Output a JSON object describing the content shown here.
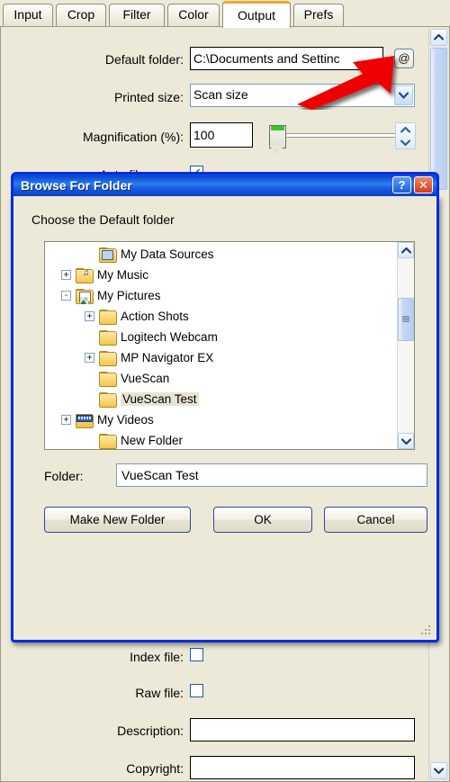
{
  "app": {
    "tabs": [
      {
        "label": "Input",
        "active": false
      },
      {
        "label": "Crop",
        "active": false
      },
      {
        "label": "Filter",
        "active": false
      },
      {
        "label": "Color",
        "active": false
      },
      {
        "label": "Output",
        "active": true
      },
      {
        "label": "Prefs",
        "active": false
      }
    ],
    "fields": {
      "default_folder_label": "Default folder:",
      "default_folder_value": "C:\\Documents and Settinc",
      "browse_button_glyph": "@",
      "printed_size_label": "Printed size:",
      "printed_size_value": "Scan size",
      "magnification_label": "Magnification (%):",
      "magnification_value": "100",
      "auto_file_name_label": "Auto file name:",
      "auto_file_name_checked": "✔",
      "index_file_label": "Index file:",
      "index_file_checked": "",
      "raw_file_label": "Raw file:",
      "raw_file_checked": "",
      "description_label": "Description:",
      "description_value": "",
      "copyright_label": "Copyright:",
      "copyright_value": ""
    },
    "accent_color": "#f0a830"
  },
  "dialog": {
    "title": "Browse For Folder",
    "help_button": "?",
    "close_button": "✕",
    "prompt": "Choose the Default folder",
    "tree": [
      {
        "label": "My Data Sources",
        "indent": 1,
        "expander": "",
        "icon": "special-folder",
        "selected": false
      },
      {
        "label": "My Music",
        "indent": 0,
        "expander": "+",
        "icon": "music-folder",
        "selected": false
      },
      {
        "label": "My Pictures",
        "indent": 0,
        "expander": "-",
        "icon": "pictures-folder",
        "selected": false
      },
      {
        "label": "Action Shots",
        "indent": 1,
        "expander": "+",
        "icon": "folder",
        "selected": false
      },
      {
        "label": "Logitech Webcam",
        "indent": 1,
        "expander": "",
        "icon": "folder",
        "selected": false
      },
      {
        "label": "MP Navigator EX",
        "indent": 1,
        "expander": "+",
        "icon": "folder",
        "selected": false
      },
      {
        "label": "VueScan",
        "indent": 1,
        "expander": "",
        "icon": "folder",
        "selected": false
      },
      {
        "label": "VueScan Test",
        "indent": 1,
        "expander": "",
        "icon": "folder",
        "selected": true
      },
      {
        "label": "My Videos",
        "indent": 0,
        "expander": "+",
        "icon": "video-folder",
        "selected": false
      },
      {
        "label": "New Folder",
        "indent": 1,
        "expander": "",
        "icon": "folder",
        "selected": false
      }
    ],
    "folder_label": "Folder:",
    "folder_value": "VueScan Test",
    "buttons": {
      "make_new_folder": "Make New Folder",
      "ok": "OK",
      "cancel": "Cancel"
    },
    "title_bar_color": "#0a48d2"
  },
  "annotation": {
    "arrow_color": "#ee0000",
    "points_to": "browse-folder-at-button"
  }
}
